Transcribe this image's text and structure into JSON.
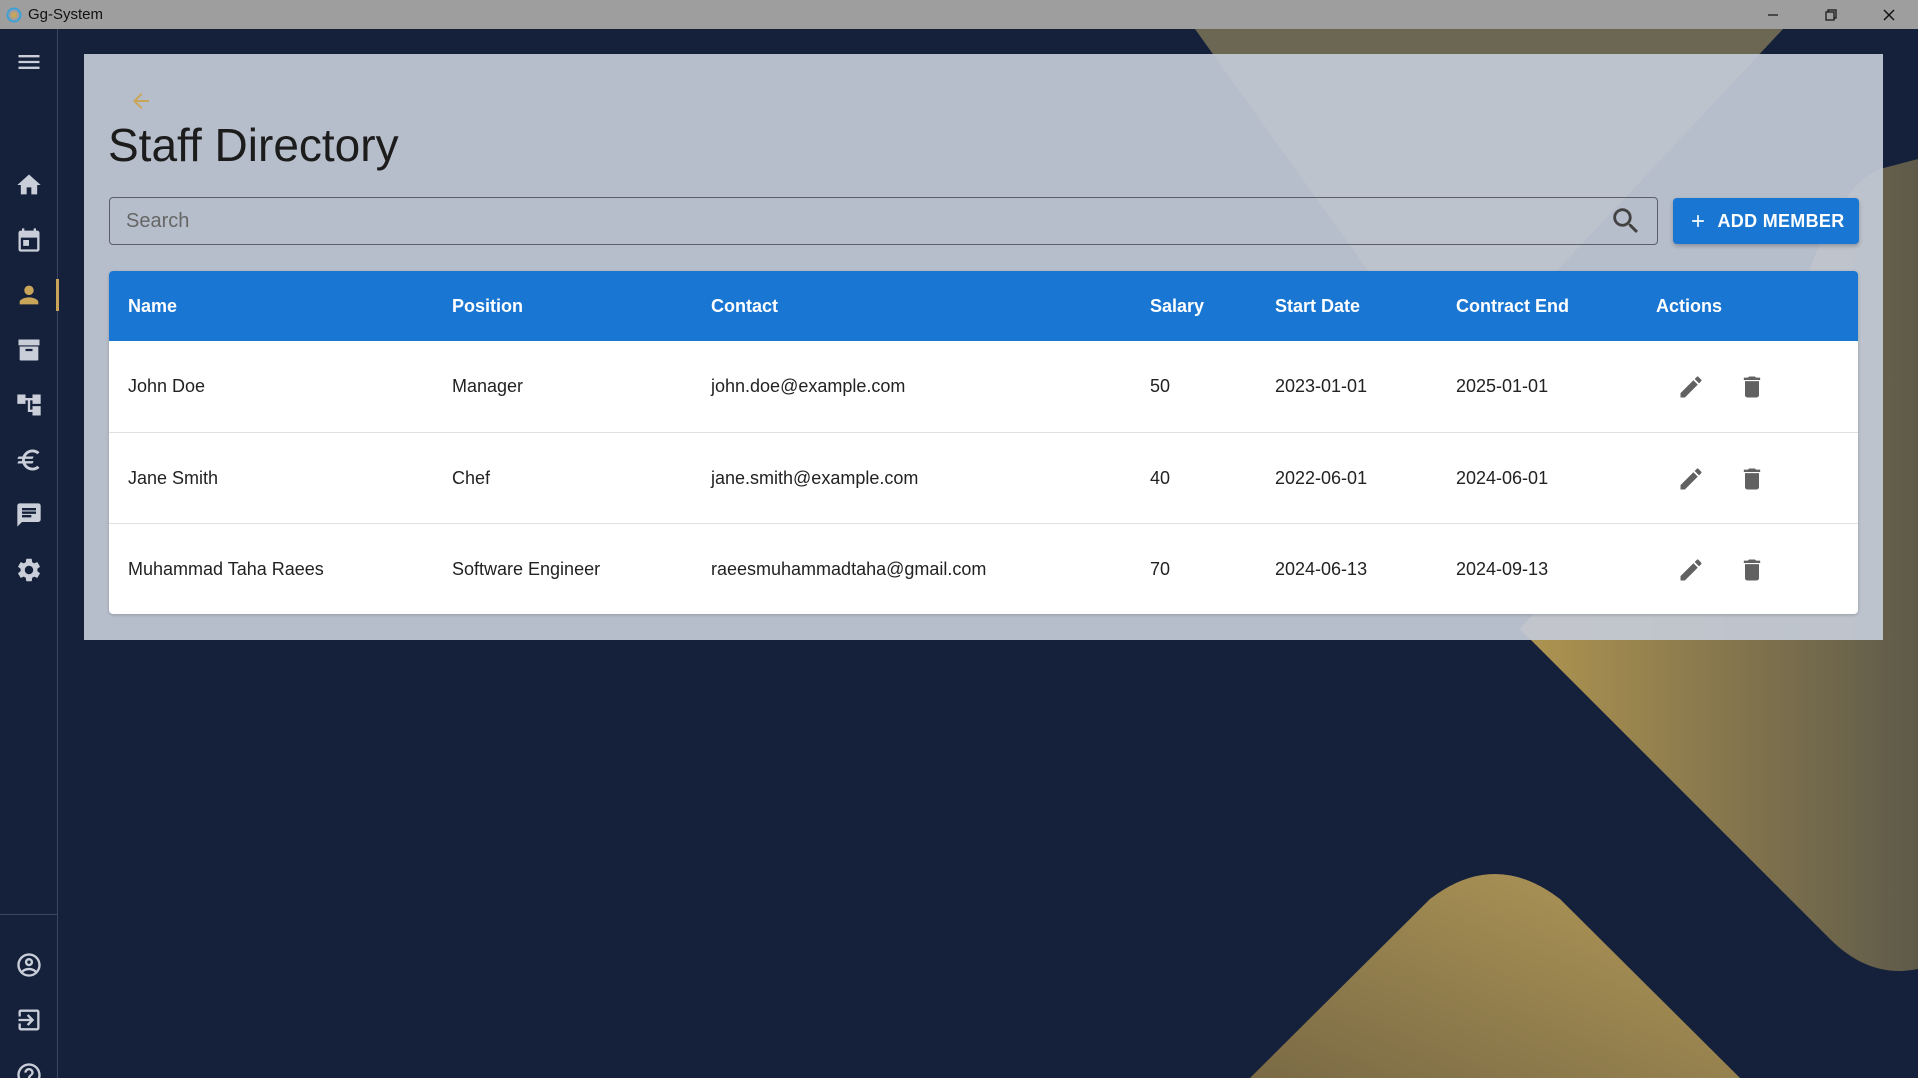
{
  "window": {
    "title": "Gg-System"
  },
  "colors": {
    "accent": "#1976d2",
    "gold": "#c9a55a",
    "navy": "#15213b"
  },
  "sidebar": {
    "top_items": [
      {
        "icon": "menu-icon"
      },
      {
        "icon": "home-icon"
      },
      {
        "icon": "calendar-icon"
      },
      {
        "icon": "person-icon",
        "active": true
      },
      {
        "icon": "archive-icon"
      },
      {
        "icon": "hierarchy-icon"
      },
      {
        "icon": "euro-icon"
      },
      {
        "icon": "chat-icon"
      },
      {
        "icon": "settings-icon"
      }
    ],
    "bottom_items": [
      {
        "icon": "account-circle-icon"
      },
      {
        "icon": "logout-icon"
      },
      {
        "icon": "help-icon"
      }
    ]
  },
  "page": {
    "title": "Staff Directory"
  },
  "search": {
    "placeholder": "Search",
    "value": ""
  },
  "add_button": {
    "label": "ADD MEMBER"
  },
  "table": {
    "columns": [
      "Name",
      "Position",
      "Contact",
      "Salary",
      "Start Date",
      "Contract End",
      "Actions"
    ],
    "rows": [
      {
        "name": "John Doe",
        "position": "Manager",
        "contact": "john.doe@example.com",
        "salary": "50",
        "start": "2023-01-01",
        "end": "2025-01-01"
      },
      {
        "name": "Jane Smith",
        "position": "Chef",
        "contact": "jane.smith@example.com",
        "salary": "40",
        "start": "2022-06-01",
        "end": "2024-06-01"
      },
      {
        "name": "Muhammad Taha Raees",
        "position": "Software Engineer",
        "contact": "raeesmuhammadtaha@gmail.com",
        "salary": "70",
        "start": "2024-06-13",
        "end": "2024-09-13"
      }
    ]
  }
}
